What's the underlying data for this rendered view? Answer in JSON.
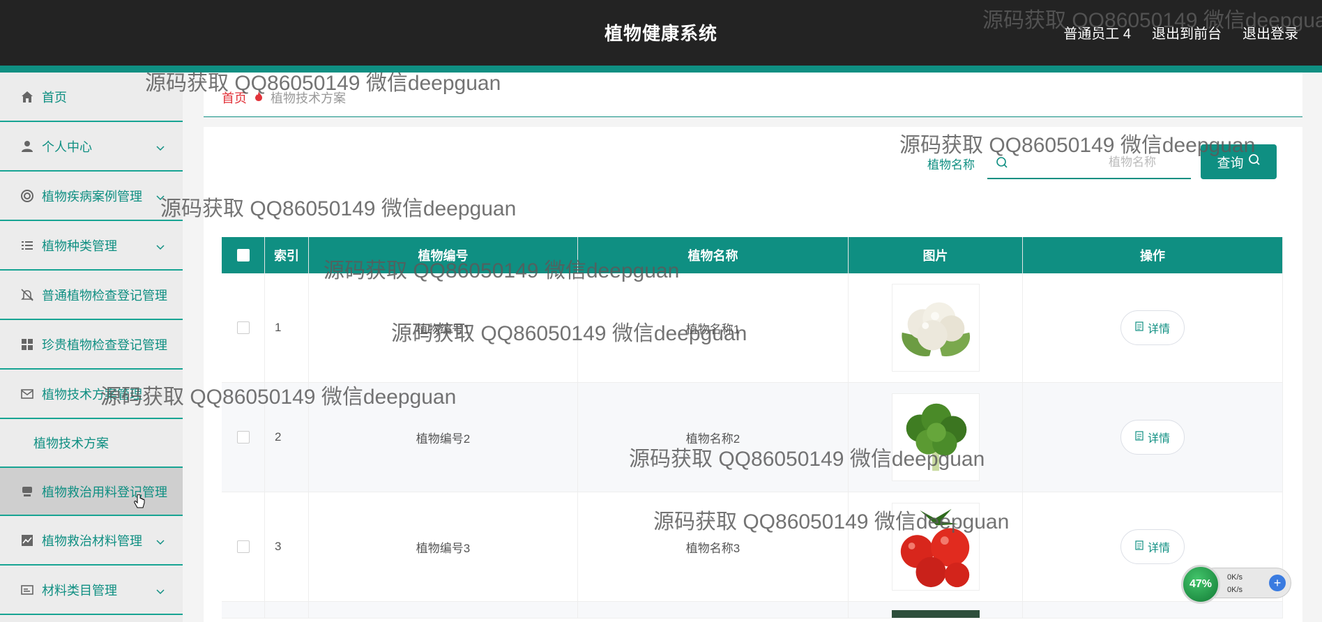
{
  "header": {
    "app_title": "植物健康系统",
    "user_label": "普通员工 4",
    "back_to_front": "退出到前台",
    "logout": "退出登录"
  },
  "sidebar": {
    "items": [
      {
        "label": "首页",
        "icon": "home-icon"
      },
      {
        "label": "个人中心",
        "icon": "user-icon"
      },
      {
        "label": "植物疾病案例管理",
        "icon": "lifebuoy-icon"
      },
      {
        "label": "植物种类管理",
        "icon": "list-icon"
      },
      {
        "label": "普通植物检查登记管理",
        "icon": "bell-off-icon"
      },
      {
        "label": "珍贵植物检查登记管理",
        "icon": "grid-icon"
      },
      {
        "label": "植物技术方案管理",
        "icon": "mail-icon"
      },
      {
        "label": "植物救治用料登记管理",
        "icon": "printer-icon"
      },
      {
        "label": "植物救治材料管理",
        "icon": "chart-icon"
      },
      {
        "label": "材料类目管理",
        "icon": "card-icon"
      }
    ],
    "sub_item": "植物技术方案"
  },
  "breadcrumb": {
    "home": "首页",
    "current": "植物技术方案"
  },
  "search": {
    "label": "植物名称",
    "placeholder": "植物名称",
    "button": "查询"
  },
  "table": {
    "headers": [
      "索引",
      "植物编号",
      "植物名称",
      "图片",
      "操作"
    ],
    "rows": [
      {
        "index": "1",
        "code": "植物编号1",
        "name": "植物名称1",
        "image": "cauliflower",
        "action": "详情"
      },
      {
        "index": "2",
        "code": "植物编号2",
        "name": "植物名称2",
        "image": "leafy-greens",
        "action": "详情"
      },
      {
        "index": "3",
        "code": "植物编号3",
        "name": "植物名称3",
        "image": "tomatoes",
        "action": "详情"
      }
    ]
  },
  "watermark": "源码获取 QQ86050149 微信deepguan",
  "net_monitor": {
    "percent": "47%",
    "up": "0K/s",
    "down": "0K/s"
  },
  "colors": {
    "accent": "#0f8f82",
    "topbar": "#232323",
    "breadcrumb_home": "#e2333a"
  }
}
